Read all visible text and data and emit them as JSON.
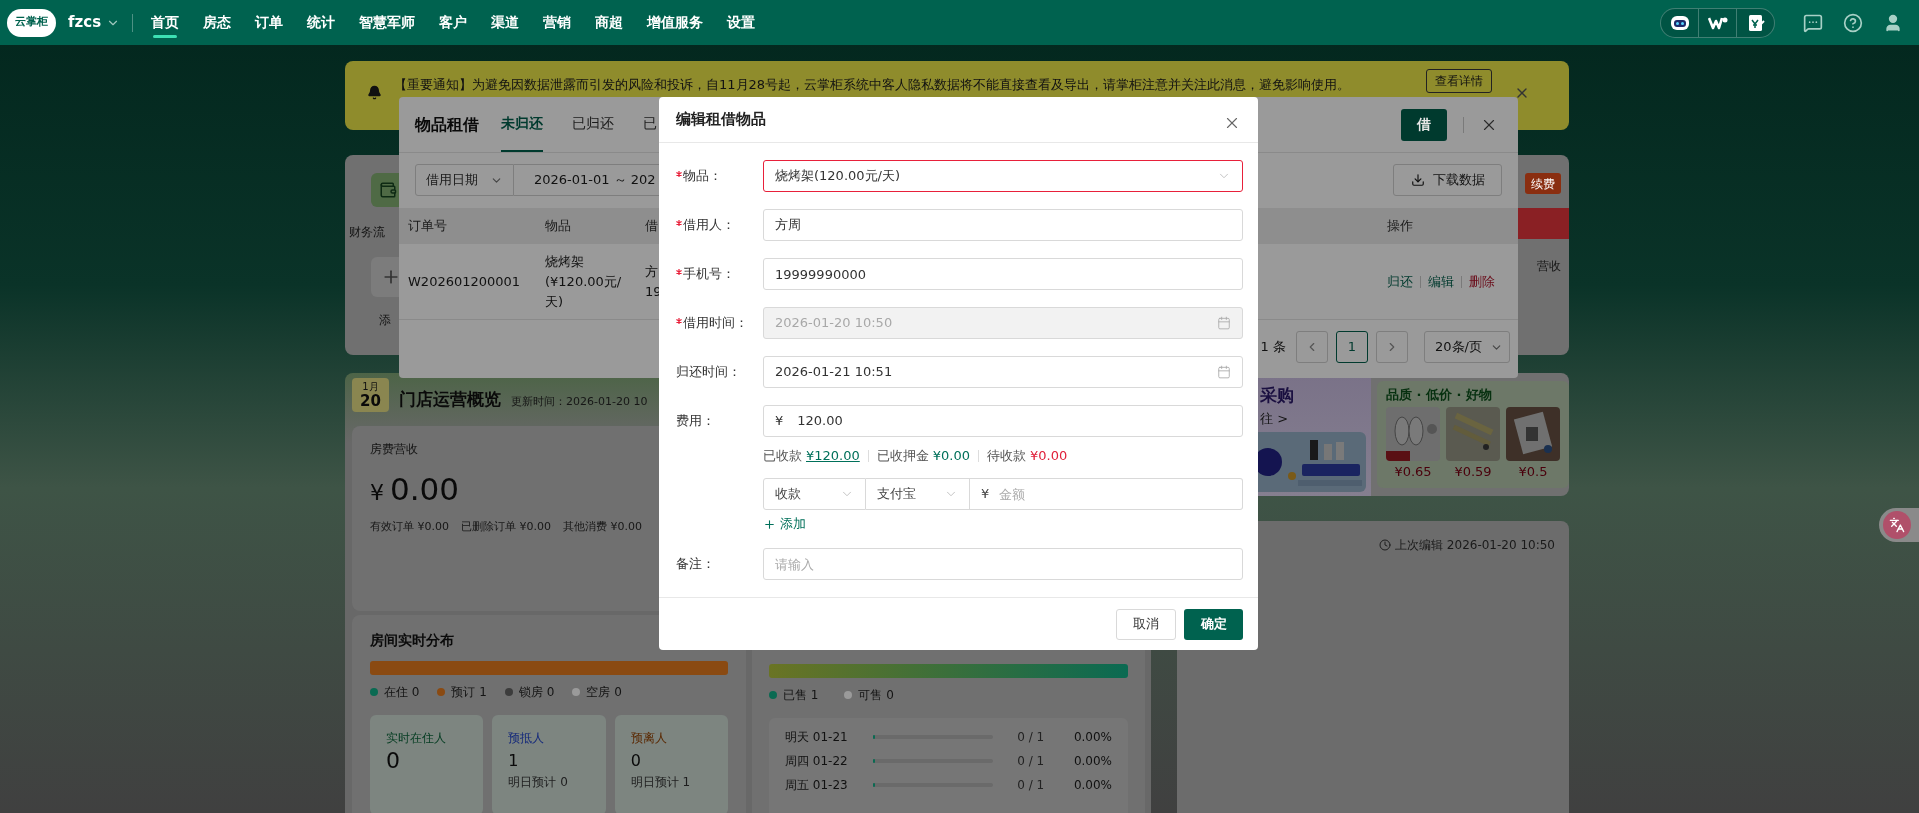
{
  "nav": {
    "logo": "云掌柜",
    "store": "fzcs",
    "items": [
      {
        "label": "首页",
        "selected": true
      },
      {
        "label": "房态",
        "selected": false
      },
      {
        "label": "订单",
        "selected": false
      },
      {
        "label": "统计",
        "selected": false
      },
      {
        "label": "智慧军师",
        "selected": false
      },
      {
        "label": "客户",
        "selected": false
      },
      {
        "label": "渠道",
        "selected": false
      },
      {
        "label": "营销",
        "selected": false
      },
      {
        "label": "商超",
        "selected": false
      },
      {
        "label": "增值服务",
        "selected": false
      },
      {
        "label": "设置",
        "selected": false
      }
    ]
  },
  "notice": {
    "text": "【重要通知】为避免因数据泄露而引发的风险和投诉，自11月28号起，云掌柜系统中客人隐私数据将不能直接查看及导出，请掌柜注意并关注此消息，避免影响使用。",
    "button": "查看详情"
  },
  "quick_card": {
    "finance": "财务流",
    "add": "添",
    "badge": "续费",
    "note": "营收"
  },
  "overview": {
    "month": "1月",
    "day": "20",
    "title": "门店运营概览",
    "updated": "更新时间：2026-01-20 10"
  },
  "revenue": {
    "label": "房费营收",
    "currency": "¥",
    "amount": "0.00",
    "details": [
      "有效订单 ¥0.00",
      "已删除订单 ¥0.00",
      "其他消费 ¥0.00"
    ]
  },
  "rooms": {
    "title": "房间实时分布",
    "legend": [
      {
        "label": "在住 0",
        "color": "#0a6a52",
        "level": 0
      },
      {
        "label": "预订 1",
        "color": "#8a4a12",
        "level": 1
      },
      {
        "label": "锁房 0",
        "color": "#3c3c3c",
        "level": 0
      },
      {
        "label": "空房 0",
        "color": "#9a9a9a",
        "level": 0
      }
    ],
    "stats": [
      {
        "title": "实时在住人",
        "value": "0",
        "color": "#053d22"
      },
      {
        "title": "预抵人",
        "value": "1",
        "note": "明日预计 0",
        "color": "#13287a"
      },
      {
        "title": "预离人",
        "value": "0",
        "note": "明日预计 1",
        "color": "#5a2800"
      }
    ]
  },
  "sales": {
    "legend": [
      {
        "label": "已售 1",
        "color": "#0a6a52",
        "level": 1
      },
      {
        "label": "可售 0",
        "color": "#9a9a9a",
        "level": 0
      }
    ],
    "days": [
      {
        "day": "明天 01-21",
        "ratio": "0 / 1",
        "percent": "0.00%",
        "level": 0
      },
      {
        "day": "周四 01-22",
        "ratio": "0 / 1",
        "percent": "0.00%",
        "level": 0
      },
      {
        "day": "周五 01-23",
        "ratio": "0 / 1",
        "percent": "0.00%",
        "level": 0
      }
    ]
  },
  "promo": {
    "title": "采购",
    "link": "往 >"
  },
  "deals": {
    "title": "品质 · 低价 · 好物",
    "products": [
      {
        "price": "¥0.65"
      },
      {
        "price": "¥0.59"
      },
      {
        "price": "¥0.5"
      }
    ]
  },
  "last_edit": "上次编辑 2026-01-20 10:50",
  "rental": {
    "title": "物品租借",
    "tabs": [
      {
        "label": "未归还",
        "selected": true
      },
      {
        "label": "已归还",
        "selected": false
      },
      {
        "label": "已",
        "selected": false
      }
    ],
    "borrow_button": "借",
    "date_filter": "借用日期",
    "date_range": "2026-01-01 ～ 202",
    "download": "下载数据",
    "columns": [
      "订单号",
      "物品",
      "借",
      "操作"
    ],
    "rows": [
      {
        "order": "W202601200001",
        "item": "烧烤架(¥120.00元/天)",
        "borrower": "方",
        "phone": "19",
        "actions": [
          {
            "label": "归还",
            "kind": "normal"
          },
          {
            "label": "编辑",
            "kind": "normal"
          },
          {
            "label": "删除",
            "kind": "danger"
          }
        ]
      }
    ],
    "total": "1 条",
    "page": "1",
    "page_size": "20条/页"
  },
  "editor": {
    "title": "编辑租借物品",
    "fields": [
      {
        "label": "物品：",
        "kind": "select",
        "value": "烧烤架(120.00元/天)",
        "required": true,
        "error": true,
        "disabled": false
      },
      {
        "label": "借用人：",
        "kind": "text",
        "value": "方周",
        "required": true,
        "error": false,
        "disabled": false
      },
      {
        "label": "手机号：",
        "kind": "text",
        "value": "19999990000",
        "required": true,
        "error": false,
        "disabled": false
      },
      {
        "label": "借用时间：",
        "kind": "date",
        "value": "2026-01-20 10:50",
        "required": true,
        "error": false,
        "disabled": true
      },
      {
        "label": "归还时间：",
        "kind": "date",
        "value": "2026-01-21 10:51",
        "required": false,
        "error": false,
        "disabled": false
      },
      {
        "label": "费用：",
        "kind": "money",
        "prefix": "¥",
        "value": "120.00",
        "required": false,
        "error": false,
        "disabled": false
      }
    ],
    "summary": [
      {
        "label": "已收款",
        "amount": "¥120.00",
        "kind": "link"
      },
      {
        "label": "已收押金",
        "amount": "¥0.00",
        "kind": "paid"
      },
      {
        "label": "待收款",
        "amount": "¥0.00",
        "kind": "due"
      }
    ],
    "payment": {
      "type": "收款",
      "method": "支付宝",
      "prefix": "¥",
      "placeholder": "金额"
    },
    "add": "添加",
    "remark": {
      "label": "备注：",
      "placeholder": "请输入"
    },
    "cancel": "取消",
    "confirm": "确定"
  }
}
